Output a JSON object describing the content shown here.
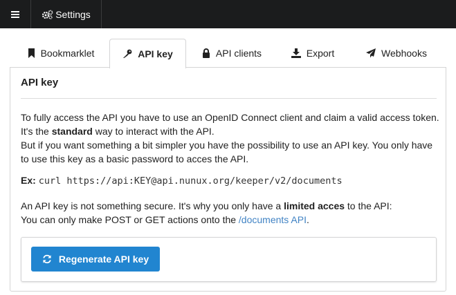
{
  "topbar": {
    "menu_icon": "hamburger-icon",
    "settings_label": "Settings",
    "settings_icon": "cogs-icon"
  },
  "tabs": [
    {
      "label": "Bookmarklet",
      "icon": "bookmark-icon",
      "active": false
    },
    {
      "label": "API key",
      "icon": "key-icon",
      "active": true
    },
    {
      "label": "API clients",
      "icon": "lock-icon",
      "active": false
    },
    {
      "label": "Export",
      "icon": "download-icon",
      "active": false
    },
    {
      "label": "Webhooks",
      "icon": "paper-plane-icon",
      "active": false
    }
  ],
  "panel": {
    "title": "API key",
    "p1_a": "To fully access the API you have to use an OpenID Connect client and claim a valid access token. It's the ",
    "p1_bold": "standard",
    "p1_b": " way to interact with the API.",
    "p1_c": "But if you want something a bit simpler you have the possibility to use an API key. You only have to use this key as a basic password to acces the API.",
    "example_label": "Ex:",
    "example_code": "curl https://api:KEY@api.nunux.org/keeper/v2/documents",
    "p2_a": "An API key is not something secure. It's why you only have a ",
    "p2_bold": "limited acces",
    "p2_b": " to the API:",
    "p3_a": "You can only make POST or GET actions onto the ",
    "p3_link": "/documents API",
    "p3_b": ".",
    "button_label": "Regenerate API key",
    "button_icon": "refresh-icon"
  },
  "colors": {
    "topbar": "#1b1c1d",
    "primary": "#2185d0",
    "link": "#4183c4"
  }
}
